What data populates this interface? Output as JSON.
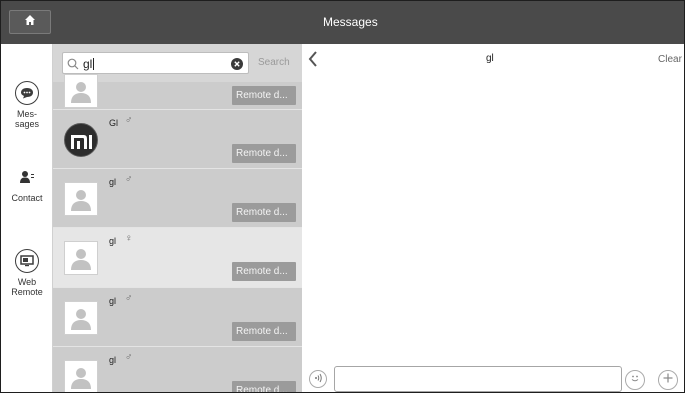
{
  "topbar": {
    "title": "Messages",
    "home_icon": "home-icon"
  },
  "nav": [
    {
      "label": "Mes-\nsages",
      "icon": "chat-bubble-icon"
    },
    {
      "label": "Contact",
      "icon": "contact-icon"
    },
    {
      "label": "Web\nRemote",
      "icon": "monitor-icon"
    }
  ],
  "search": {
    "value": "gl",
    "button": "Search"
  },
  "conversations": [
    {
      "name": "",
      "gender": "",
      "remote_label": "Remote d...",
      "avatar": "default"
    },
    {
      "name": "Gl",
      "gender": "♂",
      "remote_label": "Remote d...",
      "avatar": "brand"
    },
    {
      "name": "gl",
      "gender": "♂",
      "remote_label": "Remote d...",
      "avatar": "default"
    },
    {
      "name": "gl",
      "gender": "♀",
      "remote_label": "Remote d...",
      "avatar": "default"
    },
    {
      "name": "gl",
      "gender": "♂",
      "remote_label": "Remote d...",
      "avatar": "default"
    },
    {
      "name": "gl",
      "gender": "♂",
      "remote_label": "Remote d...",
      "avatar": "default"
    }
  ],
  "chat": {
    "title": "gl",
    "clear_label": "Clear",
    "message_value": ""
  },
  "colors": {
    "topbar": "#4a4a4a",
    "list_bg": "#cccccc",
    "selected_row": "#e6e6e6",
    "remote_button": "#9b9b9b"
  }
}
